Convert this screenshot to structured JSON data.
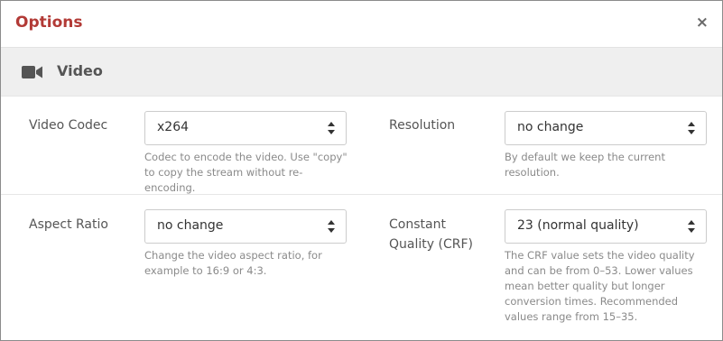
{
  "dialog": {
    "title": "Options",
    "close_glyph": "×"
  },
  "section": {
    "icon": "video-camera-icon",
    "label": "Video"
  },
  "fields": {
    "video_codec": {
      "label": "Video Codec",
      "value": "x264",
      "help": "Codec to encode the video. Use \"copy\" to copy the stream without re-encoding."
    },
    "resolution": {
      "label": "Resolution",
      "value": "no change",
      "help": "By default we keep the current resolution."
    },
    "aspect_ratio": {
      "label": "Aspect Ratio",
      "value": "no change",
      "help": "Change the video aspect ratio, for example to 16:9 or 4:3."
    },
    "crf": {
      "label_line1": "Constant",
      "label_line2": "Quality (CRF)",
      "value": "23 (normal quality)",
      "help": "The CRF value sets the video quality and can be from 0–53. Lower values mean better quality but longer conversion times. Recommended values range from 15–35."
    }
  },
  "colors": {
    "title": "#b23a36",
    "section_bg": "#efefef",
    "help_text": "#8a8a8a"
  }
}
